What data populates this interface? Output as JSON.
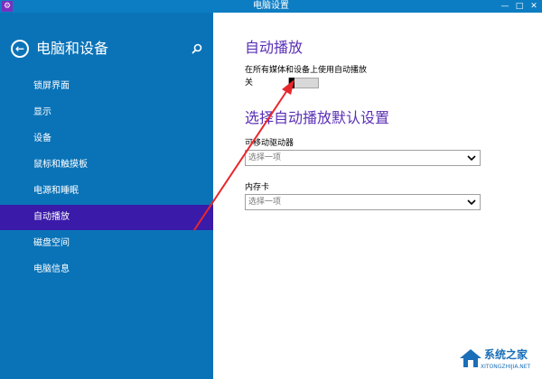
{
  "window": {
    "title": "电脑设置",
    "minimize": "—",
    "maximize": "□",
    "close": "✕",
    "app_icon": "⚙"
  },
  "sidebar": {
    "back_glyph": "←",
    "title": "电脑和设备",
    "items": [
      {
        "label": "锁屏界面"
      },
      {
        "label": "显示"
      },
      {
        "label": "设备"
      },
      {
        "label": "鼠标和触摸板"
      },
      {
        "label": "电源和睡眠"
      },
      {
        "label": "自动播放",
        "active": true
      },
      {
        "label": "磁盘空间"
      },
      {
        "label": "电脑信息"
      }
    ]
  },
  "main": {
    "autoplay_title": "自动播放",
    "autoplay_desc": "在所有媒体和设备上使用自动播放",
    "toggle_state": "关",
    "toggle_on": false,
    "defaults_title": "选择自动播放默认设置",
    "removable_label": "可移动驱动器",
    "removable_value": "选择一项",
    "memory_card_label": "内存卡",
    "memory_card_value": "选择一项"
  },
  "watermark": {
    "name": "系统之家",
    "url": "XITONGZHIJIA.NET"
  },
  "colors": {
    "titlebar": "#0d7dc3",
    "sidebar": "#0a73b8",
    "active_item": "#3a1aa8",
    "heading": "#5a2fb5",
    "annotation": "#e8272d"
  },
  "icons": [
    "search-icon",
    "back-arrow-icon",
    "chevron-down-icon",
    "settings-icon"
  ]
}
